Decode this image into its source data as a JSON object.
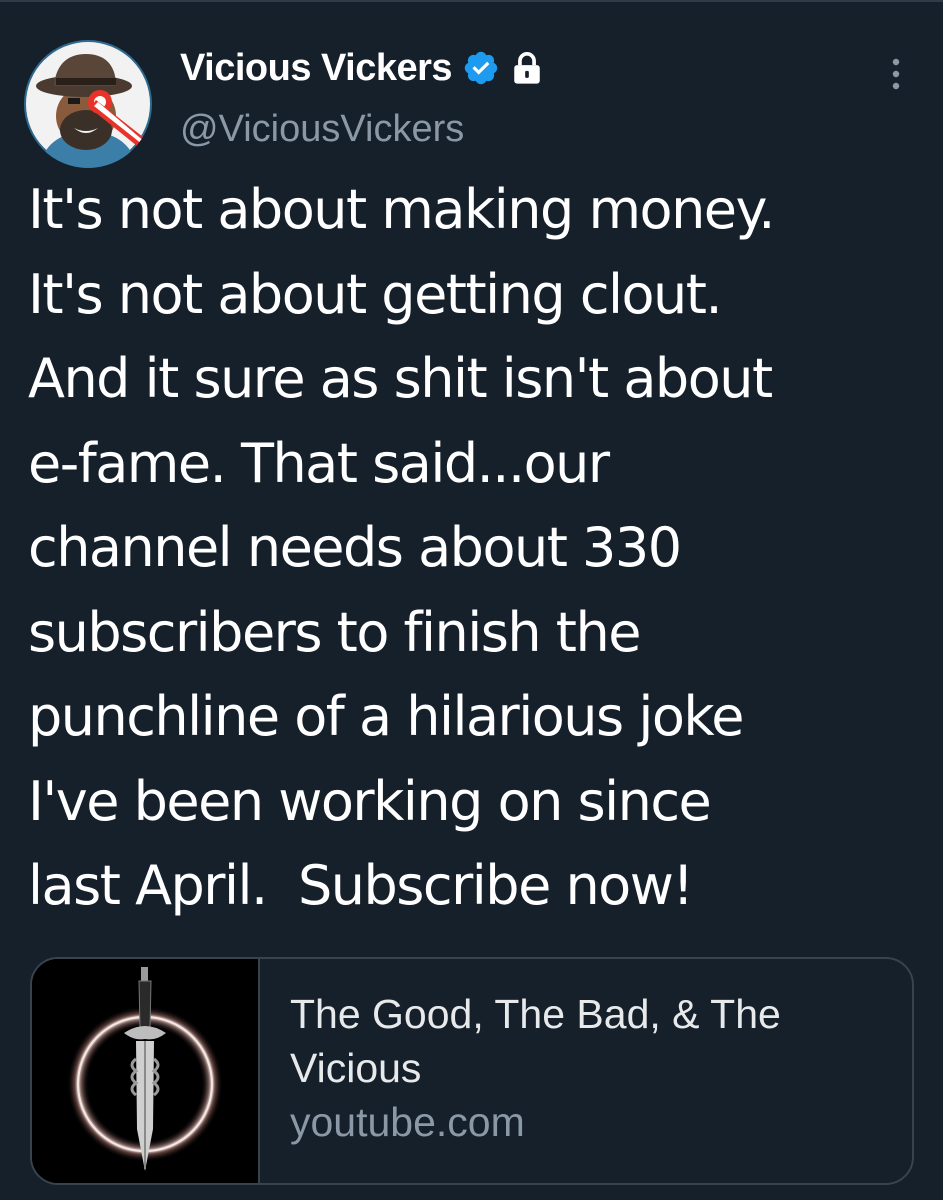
{
  "tweet": {
    "author": {
      "display_name": "Vicious Vickers",
      "handle": "@ViciousVickers",
      "verified": true,
      "protected": true,
      "avatar_icon": "bearded-man-cartoon-avatar"
    },
    "text": "It's not about making money.\nIt's not about getting clout.\nAnd it sure as shit isn't about\ne-fame. That said...our\nchannel needs about 330\nsubscribers to finish the\npunchline of a hilarious joke\nI've been working on since\nlast April.  Subscribe now!",
    "link_card": {
      "title": "The Good, The Bad, & The Vicious",
      "domain": "youtube.com",
      "thumbnail_icon": "dagger-in-glowing-ring"
    },
    "more_icon": "vertical-dots-icon"
  },
  "colors": {
    "background": "#15202b",
    "text_primary": "#ffffff",
    "text_secondary": "#8b98a5",
    "verified_blue": "#1d9bf0",
    "card_border": "#38444d"
  }
}
